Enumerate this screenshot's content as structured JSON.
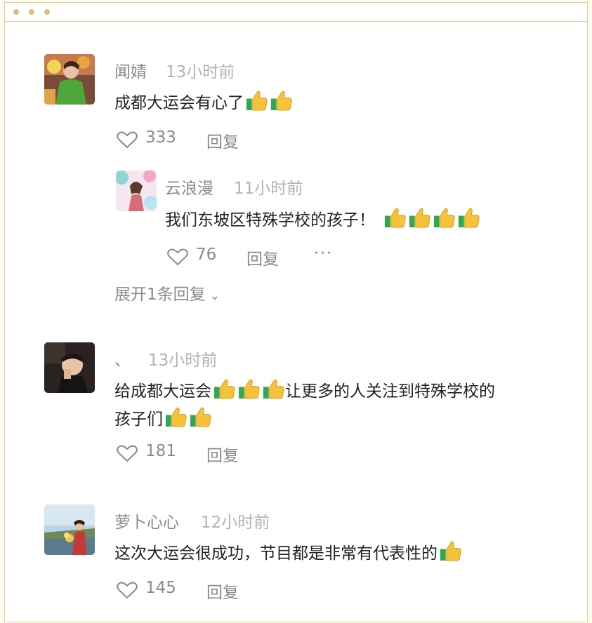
{
  "window": {
    "controls": [
      "dot",
      "dot",
      "dot"
    ]
  },
  "comments": [
    {
      "user": "闻婧",
      "time": "13小时前",
      "text": "成都大运会有心了",
      "thumbs": 2,
      "likes": "333",
      "reply": "回复",
      "replies": [
        {
          "user": "云浪漫",
          "time": "11小时前",
          "text": "我们东坡区特殊学校的孩子！",
          "thumbs": 4,
          "likes": "76",
          "reply": "回复",
          "more": "···"
        }
      ],
      "expand": "展开1条回复"
    },
    {
      "user": "、",
      "time": "13小时前",
      "text_line1_a": "给成都大运会",
      "text_line1_b": "让更多的人关注到特殊学校的",
      "text_line2": "孩子们",
      "likes": "181",
      "reply": "回复"
    },
    {
      "user": "萝卜心心",
      "time": "12小时前",
      "text": "这次大运会很成功，节目都是非常有代表性的",
      "likes": "145",
      "reply": "回复"
    }
  ],
  "icons": {
    "like": "heart-outline-icon",
    "emoji": "thumbs-up-emoji-icon"
  }
}
